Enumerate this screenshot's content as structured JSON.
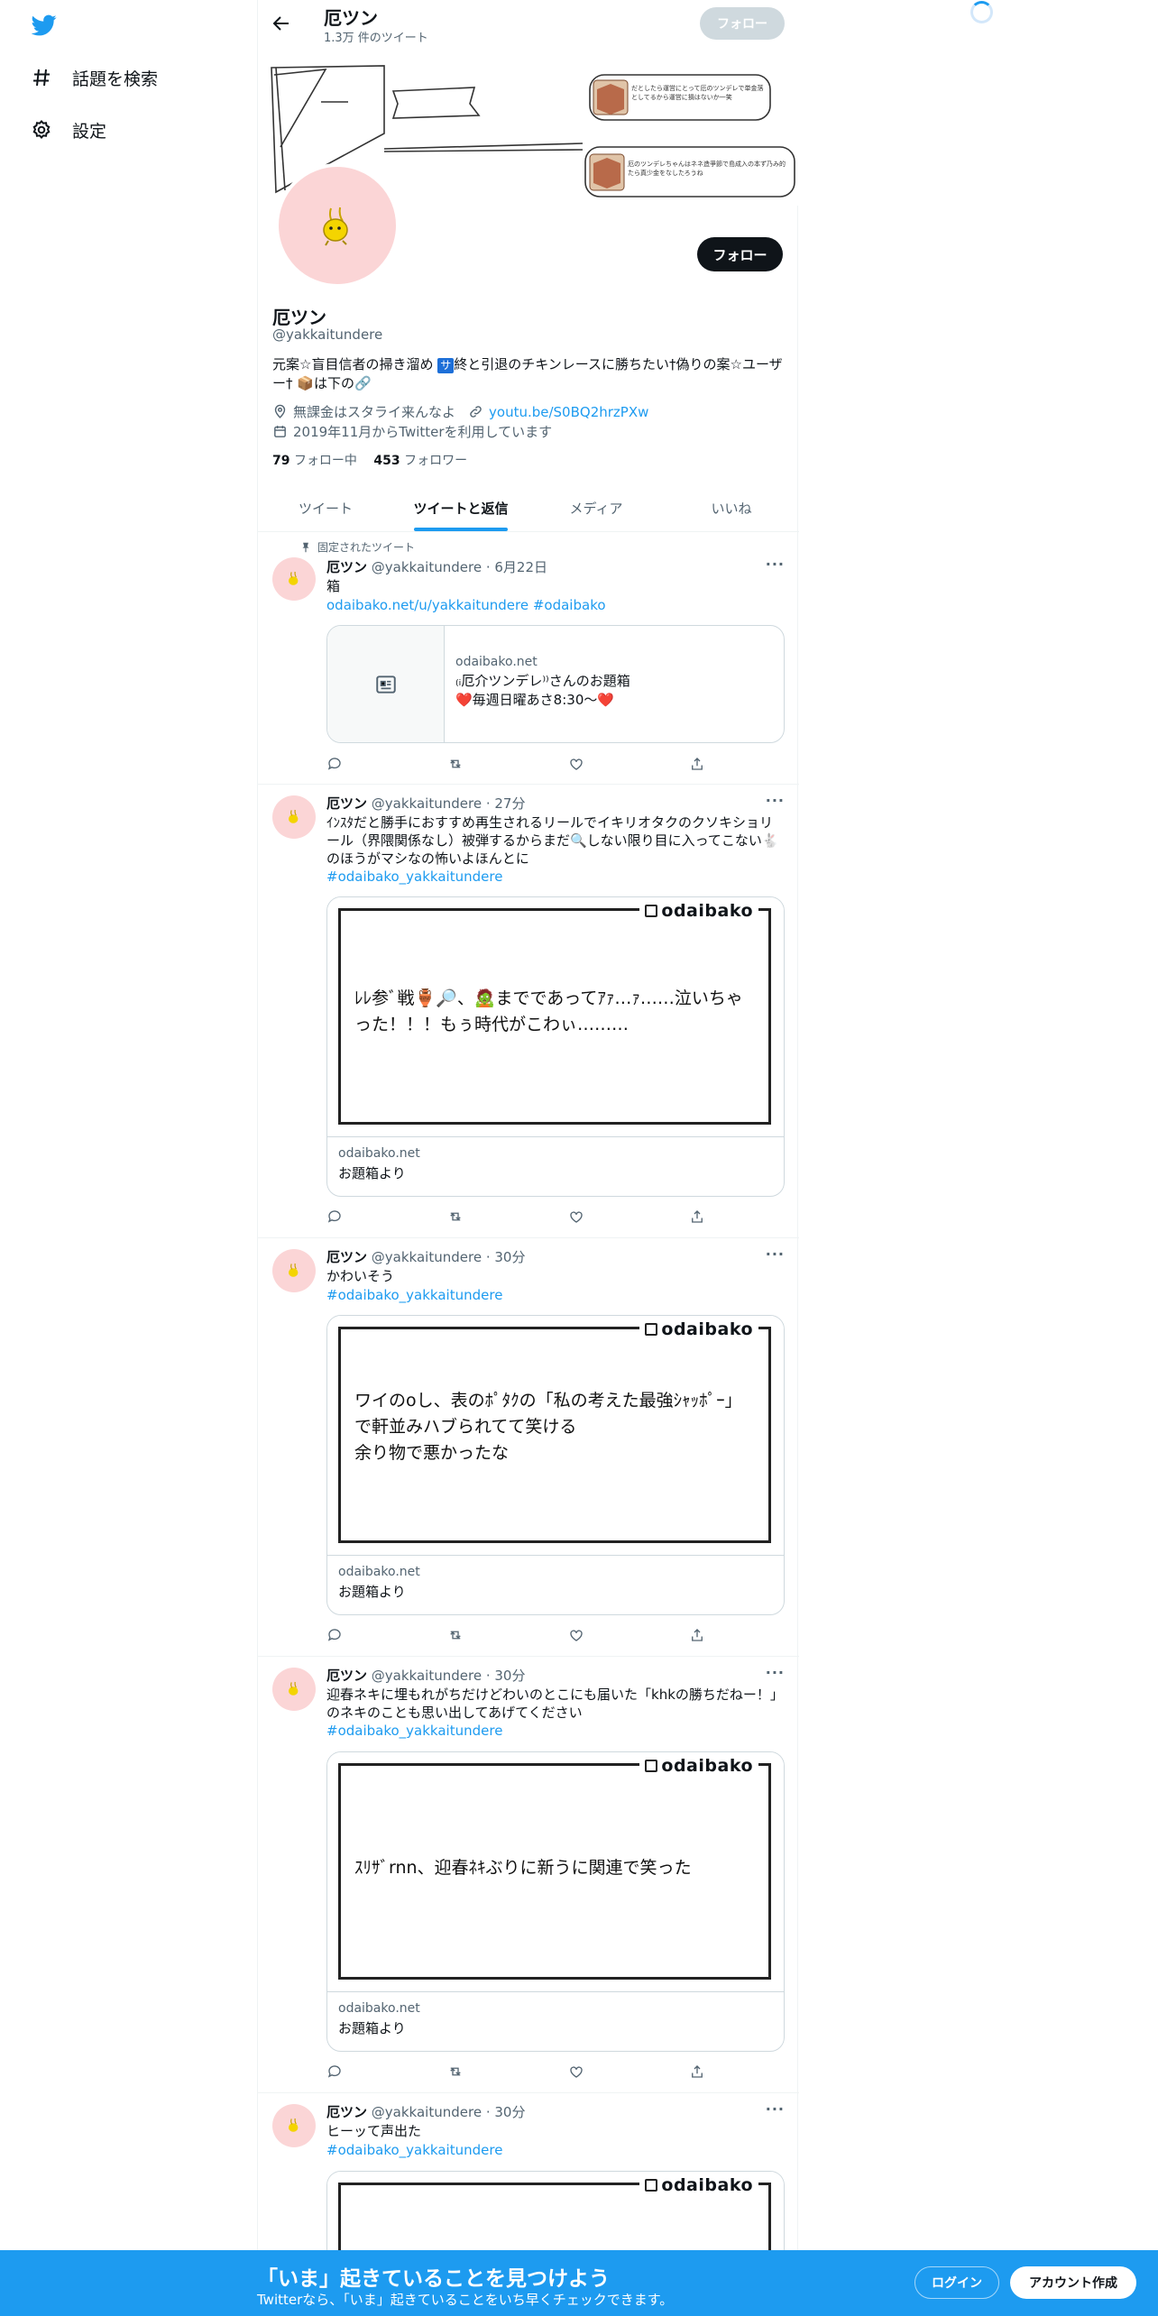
{
  "colors": {
    "brand": "#1d9bf0",
    "text": "#0f1419",
    "muted": "#536471"
  },
  "sidebar": {
    "items": [
      {
        "label": "話題を検索",
        "icon": "hashtag-icon"
      },
      {
        "label": "設定",
        "icon": "gear-icon"
      }
    ]
  },
  "header": {
    "name": "厄ツン",
    "tweet_count": "1.3万 件のツイート",
    "follow_label": "フォロー"
  },
  "banner": {
    "note1": "だとしたら運営にとって厄のツンデレで単金落としてるから運営に損はないか一笑",
    "note2": "厄のツンデレちゃんはネネ造爭節で島成入の本ず乃み的たら真少金をなしたろうね"
  },
  "profile": {
    "follow_label": "フォロー",
    "name": "厄ツン",
    "handle": "@yakkaitundere",
    "bio_part1": "元案☆盲目信者の掃き溜め ",
    "bio_badge": "サ",
    "bio_part2": "終と引退のチキンレースに勝ちたい†偽りの案☆ユーザー† 📦は下の🔗",
    "location": "無課金はスタライ来んなよ",
    "website": "youtu.be/S0BQ2hrzPXw",
    "joined": "2019年11月からTwitterを利用しています",
    "following_count": "79",
    "following_label": "フォロー中",
    "followers_count": "453",
    "followers_label": "フォロワー"
  },
  "tabs": [
    {
      "label": "ツイート"
    },
    {
      "label": "ツイートと返信"
    },
    {
      "label": "メディア"
    },
    {
      "label": "いいね"
    }
  ],
  "tweets": [
    {
      "pinned_label": "固定されたツイート",
      "name": "厄ツン",
      "handle": "@yakkaitundere",
      "time": "· 6月22日",
      "text": "箱",
      "link": "odaibako.net/u/yakkaitundere #odaibako",
      "card_domain": "odaibako.net",
      "card_title": "₍ᵢ厄介ツンデレ⁾⁾さんのお題箱",
      "card_desc": "❤️毎週日曜あさ8:30〜❤️"
    },
    {
      "name": "厄ツン",
      "handle": "@yakkaitundere",
      "time": "· 27分",
      "text": "ｲﾝｽﾀだと勝手におすすめ再生されるリールでイキリオタクのクソキショリール（界隈関係なし）被弾するからまだ🔍しない限り目に入ってこない🐇のほうがマシなの怖いよほんとに",
      "link": "#odaibako_yakkaitundere",
      "card_quote": "ﾚﾚ参ﾞ戦🏺🔎、🧟までであってｱｧ…ｧ……泣いちゃった！！！もぅ時代がこわぃ………",
      "card_domain": "odaibako.net",
      "card_title": "お題箱より"
    },
    {
      "name": "厄ツン",
      "handle": "@yakkaitundere",
      "time": "· 30分",
      "text": "かわいそう",
      "link": "#odaibako_yakkaitundere",
      "card_quote": "ワイのoし、表のﾎﾟﾀｸの「私の考えた最強ｼｬｯﾎﾟｰ」で軒並みハブられてて笑ける\n余り物で悪かったな",
      "card_domain": "odaibako.net",
      "card_title": "お題箱より"
    },
    {
      "name": "厄ツン",
      "handle": "@yakkaitundere",
      "time": "· 30分",
      "text": "迎春ネキに埋もれがちだけどわいのとこにも届いた「khkの勝ちだねー！」のネキのことも思い出してあげてください",
      "link": "#odaibako_yakkaitundere",
      "card_quote": "ｽﾘｻﾞrnn、迎春ﾈｷぶりに新うに関連で笑った",
      "card_domain": "odaibako.net",
      "card_title": "お題箱より"
    },
    {
      "name": "厄ツン",
      "handle": "@yakkaitundere",
      "time": "· 30分",
      "text": "ヒーッて声出た",
      "link": "#odaibako_yakkaitundere"
    }
  ],
  "card_brand": "odaibako",
  "bottom": {
    "title": "「いま」起きていることを見つけよう",
    "subtitle": "Twitterなら、「いま」起きていることをいち早くチェックできます。",
    "login": "ログイン",
    "signup": "アカウント作成"
  }
}
